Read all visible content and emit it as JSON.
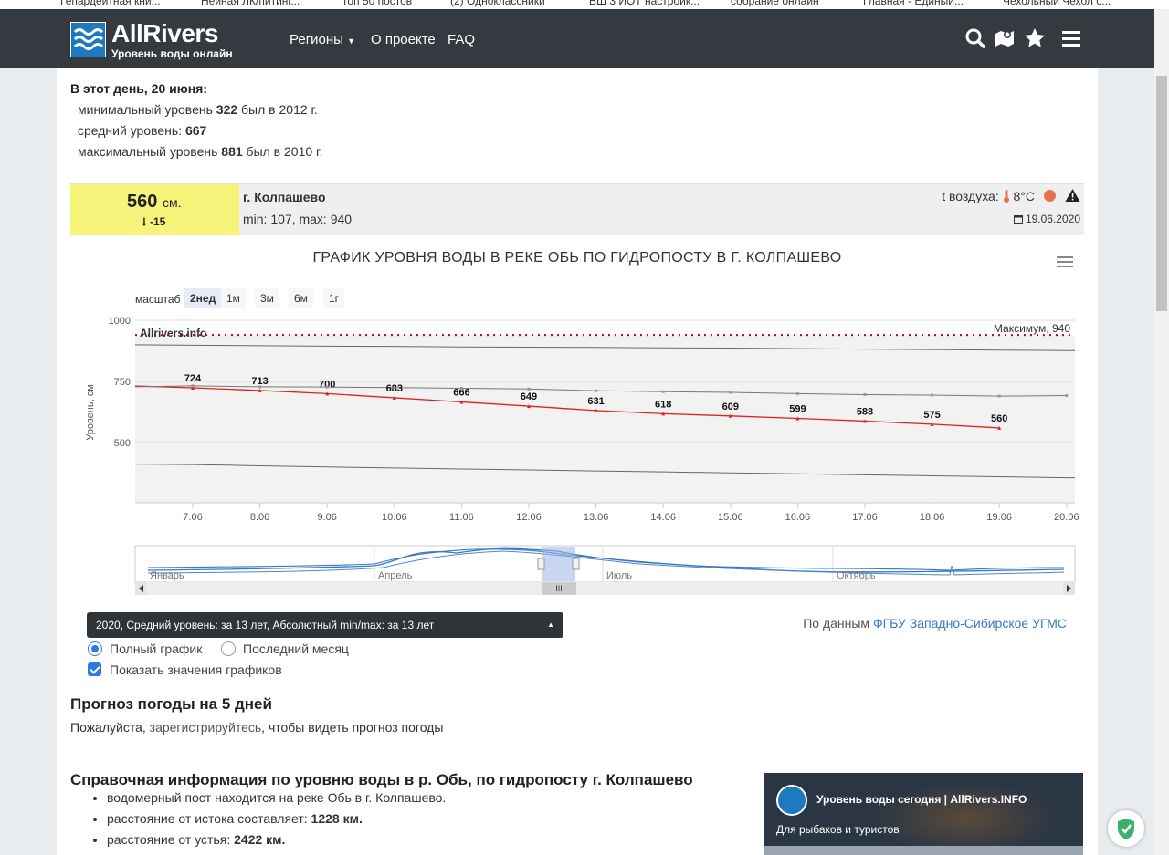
{
  "bookmarks": [
    "Гепардейтная кни...",
    "Нейная ЛК/питинг...",
    "Топ 50 постов",
    "(2) Одноклассники",
    "ВШ 3 ИОТ настройк...",
    "собрание онлайн",
    "Главная - Единый...",
    "Чехольный Чехол с..."
  ],
  "header": {
    "logo_title": "AllRivers",
    "logo_subtitle": "Уровень воды онлайн",
    "nav": [
      "Регионы",
      "О проекте",
      "FAQ"
    ],
    "icons": [
      "search-icon",
      "map-icon",
      "star-icon",
      "menu-icon"
    ]
  },
  "today": {
    "title": "В этот день, 20 июня:",
    "min_prefix": "минимальный уровень ",
    "min_value": "322",
    "min_suffix": " был в 2012 г.",
    "avg_prefix": "средний уровень: ",
    "avg_value": "667",
    "max_prefix": "максимальный уровень ",
    "max_value": "881",
    "max_suffix": " был в 2010 г."
  },
  "station": {
    "level": "560",
    "unit": "см.",
    "change": "⭣ -15",
    "name": "г. Колпашево",
    "minmax": "min: 107, max: 940",
    "temp_label": "t воздуха:",
    "temp_value": "8°C",
    "date": "19.06.2020",
    "colors": {
      "level_bg": "#f5f37a",
      "status_dot": "#e8704f"
    }
  },
  "chart": {
    "title": "ГРАФИК УРОВНЯ ВОДЫ В РЕКЕ ОБЬ ПО ГИДРОПОСТУ В Г. КОЛПАШЕВО",
    "zoom_label": "масштаб",
    "zoom_buttons": [
      "2нед",
      "1м",
      "3м",
      "6м",
      "1г"
    ],
    "zoom_active": "2нед",
    "watermark": "Allrivers.info",
    "max_label": "Максимум, 940",
    "navigator_months": [
      "Январь",
      "Апрель",
      "Июль",
      "Октябрь"
    ],
    "navigator_handle": "III"
  },
  "chart_data": {
    "type": "line",
    "ylabel": "Уровень, см",
    "ylim": [
      250,
      1000
    ],
    "yticks": [
      500,
      750,
      1000
    ],
    "x": [
      "7.06",
      "8.06",
      "9.06",
      "10.06",
      "11.06",
      "12.06",
      "13.06",
      "14.06",
      "15.06",
      "16.06",
      "17.06",
      "18.06",
      "19.06",
      "20.06"
    ],
    "series": [
      {
        "values": [
          724,
          713,
          700,
          683,
          666,
          649,
          631,
          618,
          609,
          599,
          588,
          575,
          560
        ],
        "color": "#e32020",
        "labeled": true
      },
      {
        "values": [
          732,
          728,
          727,
          725,
          722,
          719,
          712,
          708,
          705,
          700,
          696,
          694,
          690,
          692
        ],
        "color": "#777777"
      },
      {
        "values": [
          898,
          896,
          894,
          893,
          891,
          890,
          889,
          887,
          886,
          884,
          882,
          880,
          878,
          876
        ],
        "color": "#666666"
      },
      {
        "values": [
          410,
          405,
          400,
          396,
          392,
          388,
          384,
          380,
          376,
          372,
          368,
          364,
          360,
          356
        ],
        "color": "#666666"
      }
    ],
    "max_line": 940,
    "grid": true
  },
  "controls": {
    "series_select": "2020, Средний уровень: за 13 лет, Абсолютный min/max: за 13 лет",
    "source_prefix": "По данным ",
    "source_link": "ФГБУ Западно-Сибирское УГМС",
    "radio_full": "Полный график",
    "radio_month": "Последний месяц",
    "checkbox_values": "Показать значения графиков"
  },
  "weather": {
    "title": "Прогноз погоды на 5 дней",
    "text_prefix": "Пожалуйста, ",
    "text_link": "зарегистрируйтесь",
    "text_suffix": ", чтобы видеть прогноз погоды"
  },
  "info": {
    "title": "Справочная информация по уровню воды в р. Обь, по гидропосту г. Колпашево",
    "item1": "водомерный пост находится на реке Обь в г. Колпашево.",
    "item2_prefix": "расстояние от истока составляет: ",
    "item2_value": "1228 км.",
    "item3_prefix": "расстояние от устья: ",
    "item3_value": "2422 км."
  },
  "promo": {
    "title": "Уровень воды сегодня | AllRivers.INFO",
    "subtitle": "Для рыбаков и туристов"
  }
}
